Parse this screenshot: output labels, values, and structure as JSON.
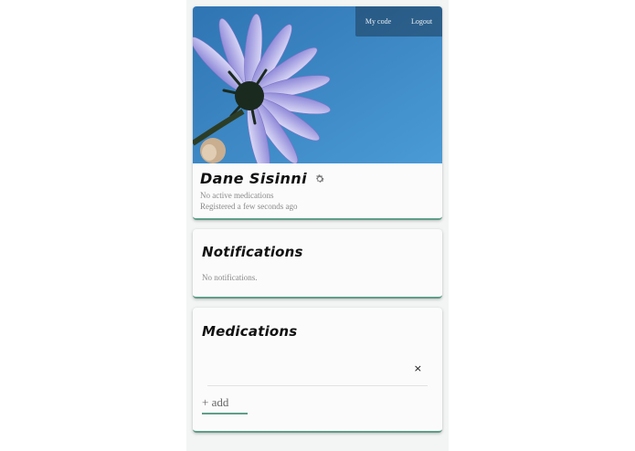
{
  "topbar": {
    "my_code": "My code",
    "logout": "Logout"
  },
  "profile": {
    "name": "Dane Sisinni",
    "medications_status": "No active medications",
    "registered": "Registered a few seconds ago"
  },
  "notifications": {
    "title": "Notifications",
    "empty_text": "No notifications."
  },
  "medications": {
    "title": "Medications",
    "remove_symbol": "×",
    "add_label": "+ add"
  },
  "colors": {
    "accent": "#5e9e88",
    "sky": "#3b87c4",
    "petal": "#b9b6ea"
  }
}
